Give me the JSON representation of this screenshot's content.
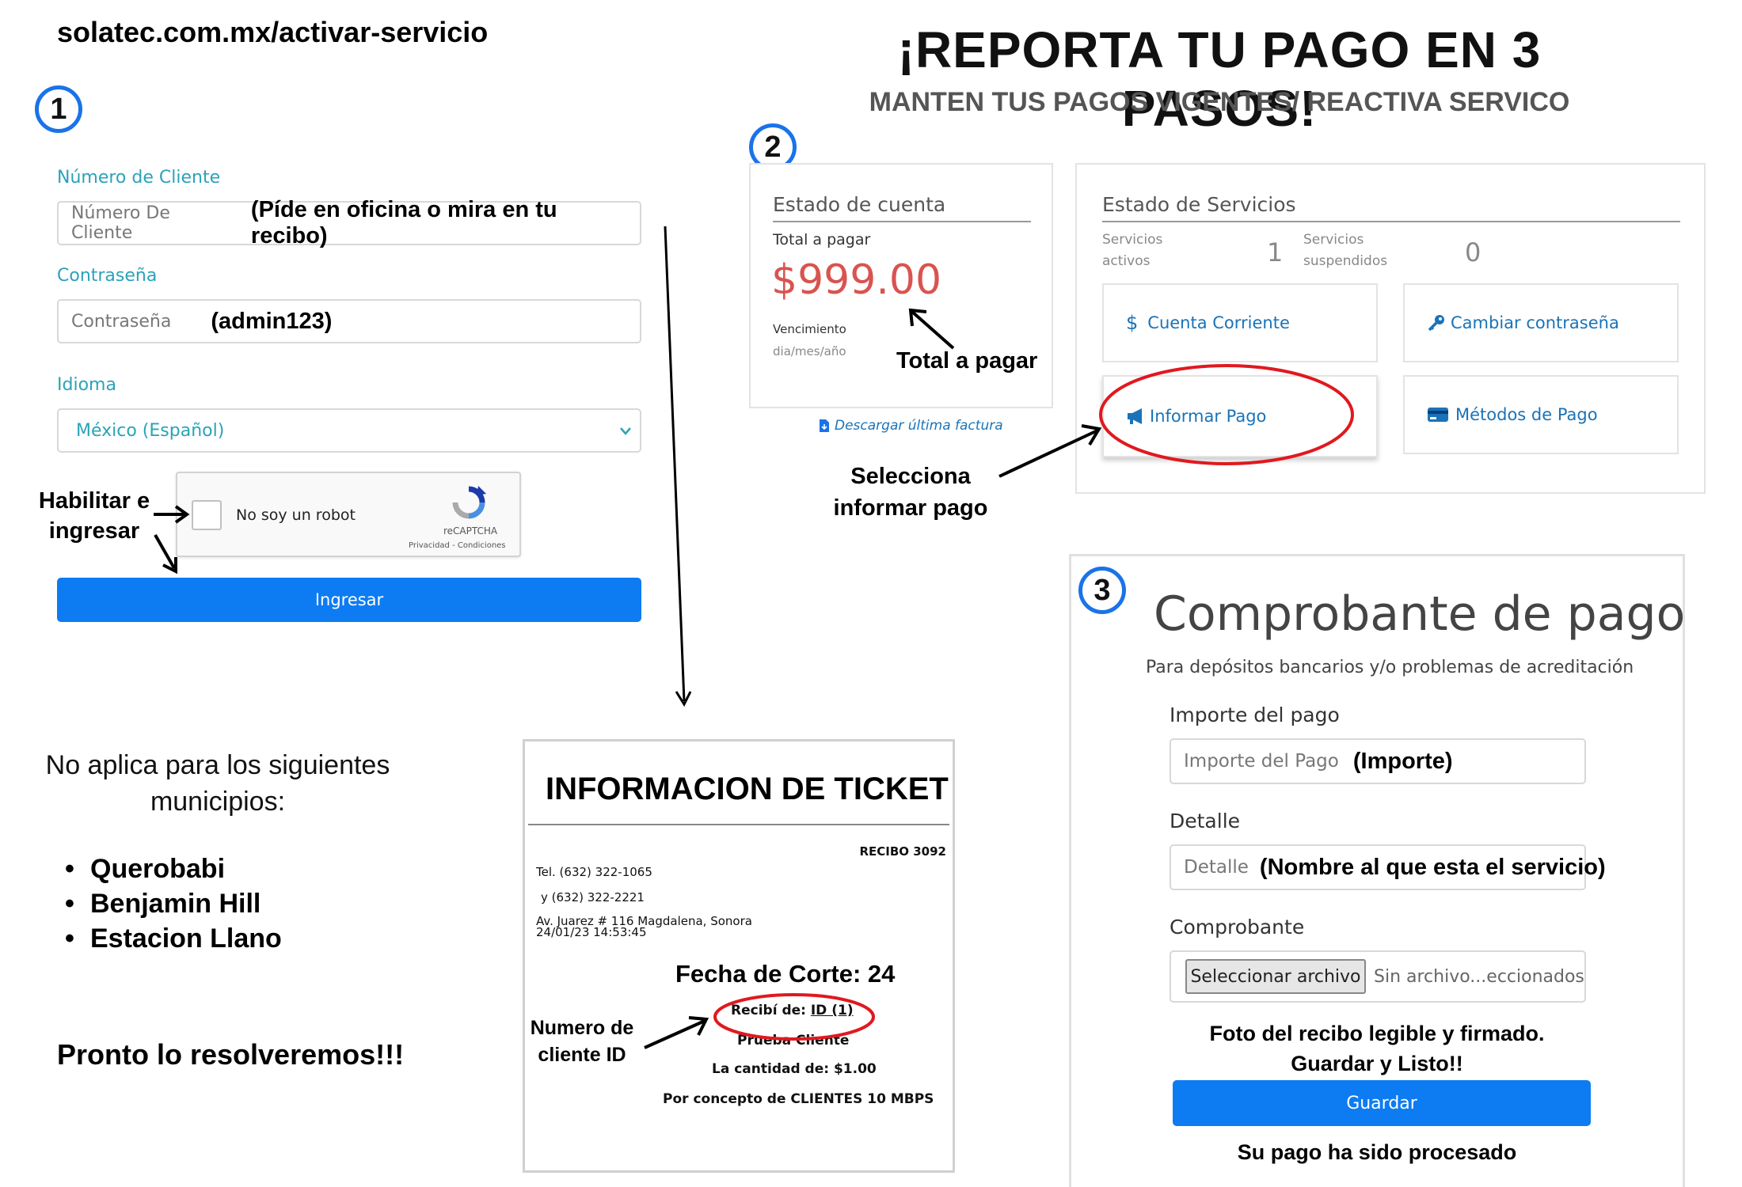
{
  "header": {
    "url": "solatec.com.mx/activar-servicio",
    "title": "¡REPORTA TU PAGO EN 3 PASOS!",
    "subtitle": "MANTEN TUS PAGOS VIGENTES/ REACTIVA SERVICO"
  },
  "steps": {
    "one": "1",
    "two": "2",
    "three": "3"
  },
  "login": {
    "client_label": "Número de Cliente",
    "client_placeholder": "Número De Cliente",
    "client_note": "(Píde en oficina o mira  en tu recibo)",
    "password_label": "Contraseña",
    "password_placeholder": "Contraseña",
    "password_note": "(admin123)",
    "language_label": "Idioma",
    "language_value": "México (Español)",
    "captcha_text": "No soy un robot",
    "captcha_brand": "reCAPTCHA",
    "captcha_links": "Privacidad - Condiciones",
    "enable_note": "Habilitar e ingresar",
    "submit_label": "Ingresar"
  },
  "notice": {
    "text": "No aplica para los siguientes municipios:",
    "municipalities": [
      "Querobabi",
      "Benjamin Hill",
      "Estacion Llano"
    ],
    "footer": "Pronto lo resolveremos!!!"
  },
  "account": {
    "heading": "Estado de cuenta",
    "total_label": "Total a pagar",
    "amount": "$999.00",
    "due_label": "Vencimiento",
    "due_value": "dia/mes/año",
    "total_note": "Total a pagar",
    "download_link": "Descargar última factura"
  },
  "services": {
    "heading": "Estado de Servicios",
    "active_label": "Servicios activos",
    "active_count": "1",
    "suspended_label": "Servicios suspendidos",
    "suspended_count": "0",
    "buttons": {
      "current_account": "Cuenta Corriente",
      "change_password": "Cambiar contraseña",
      "report_payment": "Informar Pago",
      "payment_methods": "Métodos de Pago"
    },
    "select_note": "Selecciona informar pago"
  },
  "ticket": {
    "title": "INFORMACION DE TICKET",
    "receipt": "RECIBO 3092",
    "phone1": "Tel. (632) 322-1065",
    "phone2": "y (632) 322-2221",
    "address": "Av. Juarez # 116 Magdalena, Sonora",
    "datetime": "24/01/23 14:53:45",
    "cutoff": "Fecha de Corte: 24",
    "received_prefix": "Recibí de:",
    "received_id": "ID (1)",
    "client_name": "Prueba Cliente",
    "amount_line": "La cantidad de: $1.00",
    "concept_line": "Por concepto de CLIENTES 10 MBPS",
    "client_id_note": "Numero de cliente ID"
  },
  "proof": {
    "title": "Comprobante de pago",
    "subtitle": "Para depósitos bancarios y/o problemas de acreditación",
    "amount_label": "Importe del pago",
    "amount_placeholder": "Importe del Pago",
    "amount_note": "(Importe)",
    "detail_label": "Detalle",
    "detail_placeholder": "Detalle",
    "detail_note": "(Nombre al que esta el servicio)",
    "file_label": "Comprobante",
    "file_button": "Seleccionar archivo",
    "file_status": "Sin archivo...eccionados",
    "photo_note_1": "Foto del recibo legible y firmado.",
    "photo_note_2": "Guardar y Listo!!",
    "save_label": "Guardar",
    "processed_note": "Su pago ha sido procesado"
  },
  "colors": {
    "accent_blue": "#0d7cf2",
    "teal_label": "#2aa3b8",
    "amount_red": "#d9534f",
    "highlight_red": "#e0191f"
  }
}
